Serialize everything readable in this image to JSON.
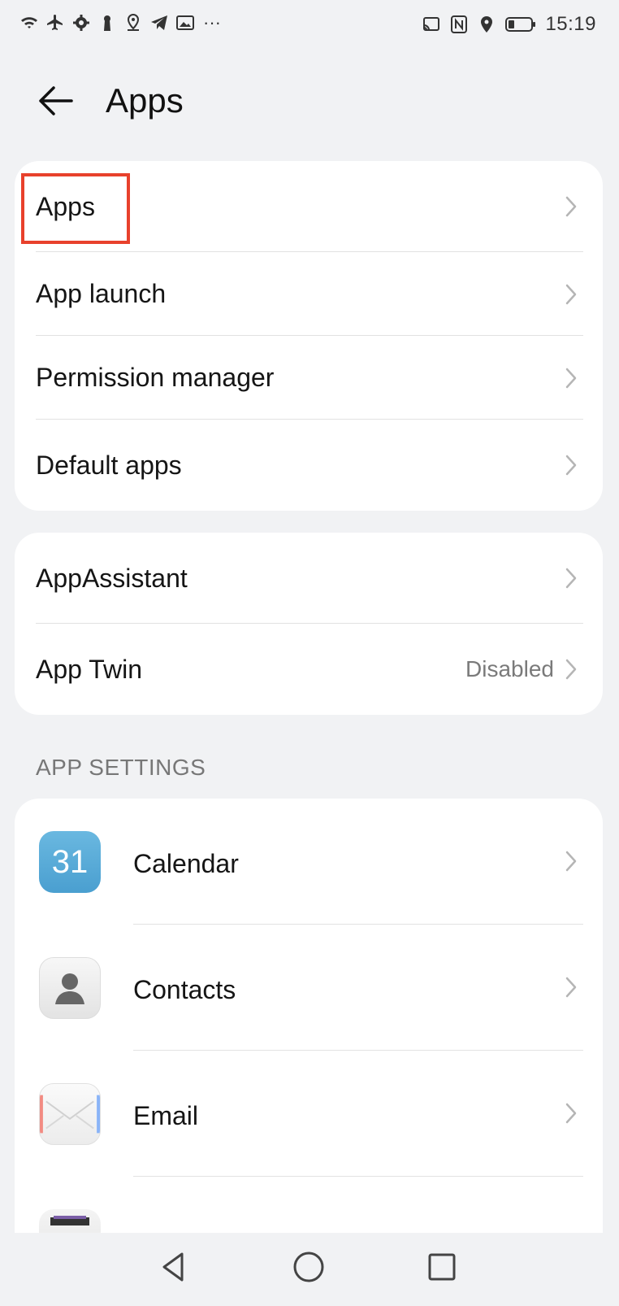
{
  "status_bar": {
    "time": "15:19",
    "overflow": "···",
    "left_icons": [
      "wifi-icon",
      "airplane-icon",
      "settings-gear-icon",
      "keyhole-icon",
      "location-pin-icon",
      "telegram-icon",
      "gallery-icon"
    ],
    "right_icons": [
      "cast-icon",
      "nfc-icon",
      "location-icon",
      "battery-icon"
    ]
  },
  "header": {
    "title": "Apps",
    "back_icon": "arrow-left-icon"
  },
  "card1": {
    "items": [
      {
        "label": "Apps"
      },
      {
        "label": "App launch"
      },
      {
        "label": "Permission manager"
      },
      {
        "label": "Default apps"
      }
    ]
  },
  "card2": {
    "items": [
      {
        "label": "AppAssistant"
      },
      {
        "label": "App Twin",
        "value": "Disabled"
      }
    ]
  },
  "section": {
    "title": "APP SETTINGS"
  },
  "apps": [
    {
      "label": "Calendar",
      "icon_text": "31",
      "icon": "calendar-icon"
    },
    {
      "label": "Contacts",
      "icon": "contacts-icon"
    },
    {
      "label": "Email",
      "icon": "email-icon"
    }
  ],
  "colors": {
    "background": "#f1f2f4",
    "highlight": "#e8412c",
    "calendar": "#4a9fd0"
  },
  "navbar": {
    "icons": [
      "back-triangle-icon",
      "home-circle-icon",
      "recents-square-icon"
    ]
  }
}
